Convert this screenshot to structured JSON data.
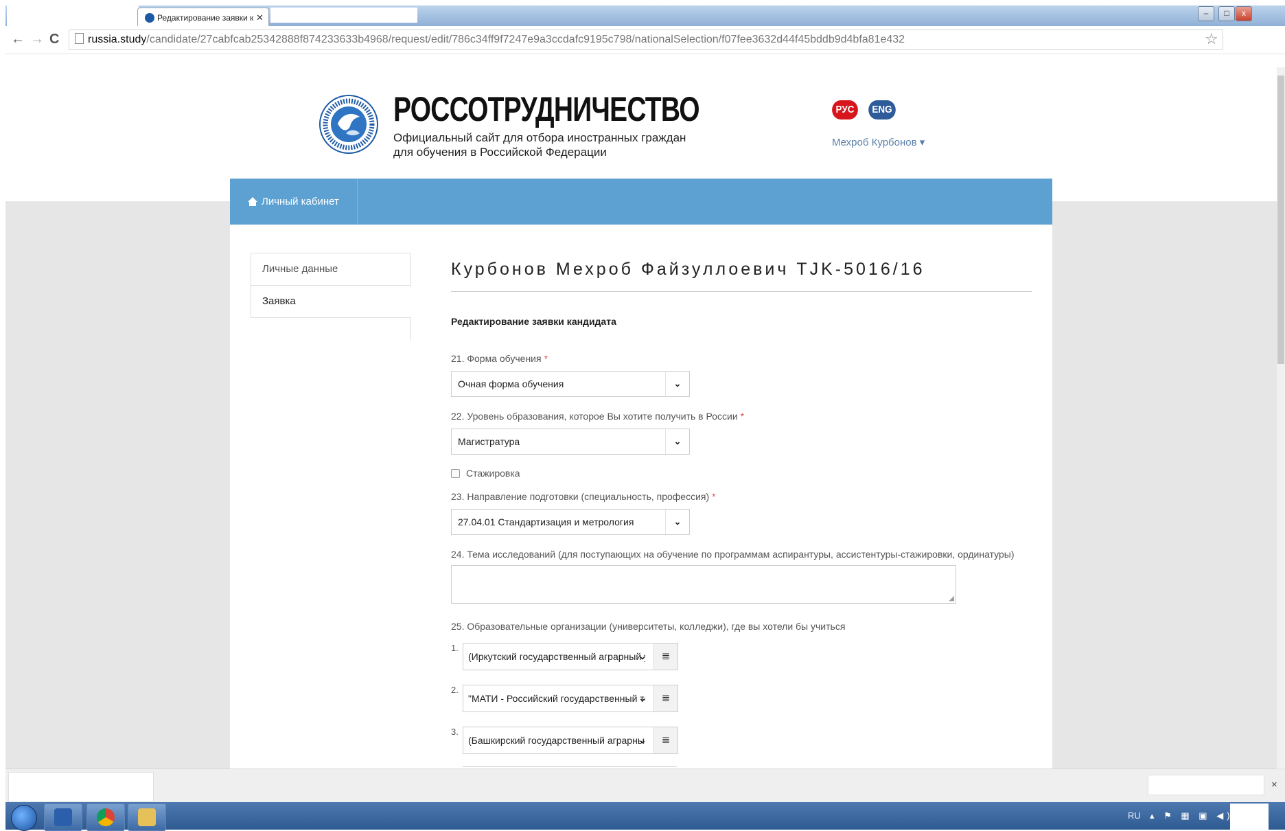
{
  "browser": {
    "tab_title": "Редактирование заявки к",
    "tab_close": "✕",
    "url_domain": "russia.study",
    "url_path": "/candidate/27cabfcab25342888f874233633b4968/request/edit/786c34ff9f7247e9a3ccdafc9195c798/nationalSelection/f07fee3632d44f45bddb9d4bfa81e432",
    "back": "←",
    "forward": "→",
    "reload": "C",
    "bookmark_star": "☆",
    "win_buttons": {
      "min": "–",
      "max": "□",
      "close": "x"
    }
  },
  "header": {
    "brand_title": "РОССОТРУДНИЧЕСТВО",
    "brand_sub_line1": "Официальный сайт для отбора иностранных граждан",
    "brand_sub_line2": "для обучения в Российской Федерации",
    "lang_ru": "РУС",
    "lang_en": "ENG",
    "user_name": "Мехроб Курбонов ▾"
  },
  "nav": {
    "home_label": "Личный кабинет"
  },
  "sidebar": {
    "items": [
      {
        "label": "Личные данные"
      },
      {
        "label": "Заявка"
      }
    ]
  },
  "main": {
    "title": "Курбонов Мехроб Файзуллоевич TJK-5016/16",
    "section_heading": "Редактирование заявки кандидата",
    "fields": {
      "form_of_study": {
        "label": "21. Форма обучения",
        "required": "*",
        "value": "Очная форма обучения"
      },
      "education_level": {
        "label": "22. Уровень образования, которое Вы хотите получить в России",
        "required": "*",
        "value": "Магистратура"
      },
      "internship": {
        "label": "Стажировка",
        "checked": false
      },
      "direction": {
        "label": "23. Направление подготовки (специальность, профессия)",
        "required": "*",
        "value": "27.04.01 Стандартизация и метрология"
      },
      "research_topic": {
        "label": "24. Тема исследований (для поступающих на обучение по программам аспирантуры, ассистентуры-стажировки, ординатуры)",
        "value": ""
      },
      "organizations": {
        "label": "25. Образовательные организации (университеты, колледжи), где вы хотели бы учиться",
        "items": [
          {
            "num": "1.",
            "value": "(Иркутский государственный аграрный университет"
          },
          {
            "num": "2.",
            "value": "\"МАТИ - Российский государственный технологический"
          },
          {
            "num": "3.",
            "value": "(Башкирский государственный аграрный университет"
          }
        ]
      }
    },
    "caret_glyph": "⌄",
    "drag_glyph": "≣"
  },
  "system": {
    "tray_lang": "RU",
    "tray_icons": "▴ ⚑ ▦ ▣ ◀)",
    "download_close": "×"
  }
}
